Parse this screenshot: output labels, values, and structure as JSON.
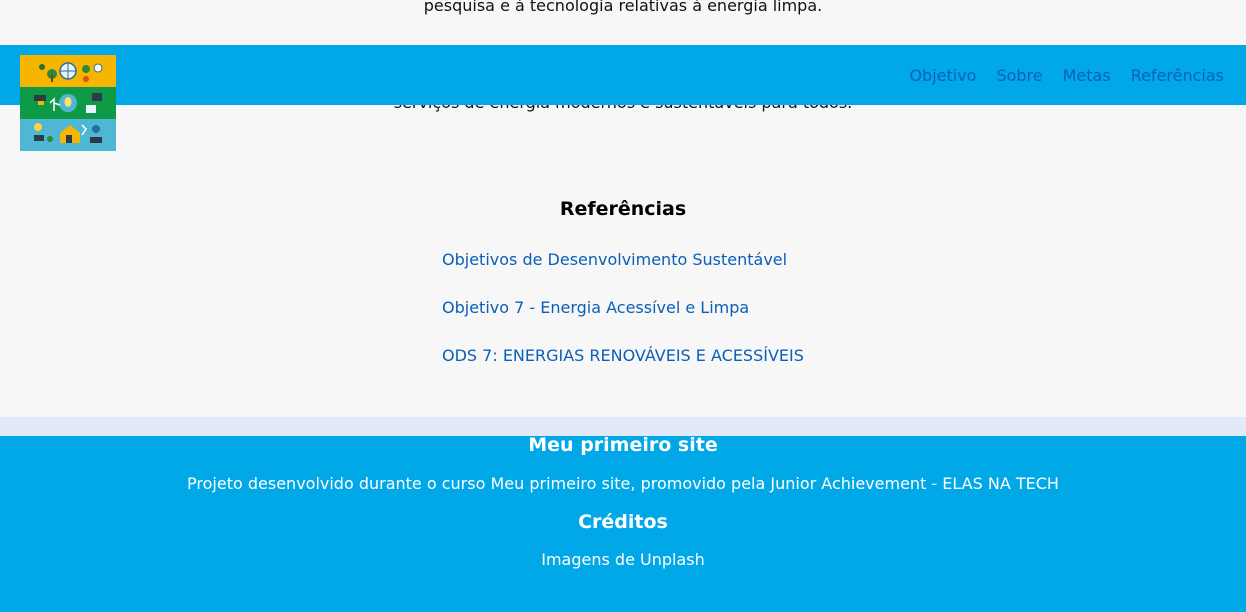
{
  "page": {
    "top_text": "pesquisa e à tecnologia relativas à energia limpa.",
    "under_header_text": "serviços de energia modernos e sustentáveis para todos."
  },
  "header": {
    "logo_alt": "energia limpa",
    "nav": [
      {
        "label": "Objetivo"
      },
      {
        "label": "Sobre"
      },
      {
        "label": "Metas"
      },
      {
        "label": "Referências"
      }
    ]
  },
  "references": {
    "title": "Referências",
    "links": [
      {
        "label": "Objetivos de Desenvolvimento Sustentável"
      },
      {
        "label": "Objetivo 7 - Energia Acessível e Limpa"
      },
      {
        "label": "ODS 7: ENERGIAS RENOVÁVEIS E ACESSÍVEIS"
      }
    ]
  },
  "footer": {
    "site_title": "Meu primeiro site",
    "site_text": "Projeto desenvolvido durante o curso Meu primeiro site, promovido pela Junior Achievement - ELAS NA TECH",
    "credits_title": "Créditos",
    "credits_text": "Imagens de Unplash"
  },
  "colors": {
    "header_bg": "#00a8e8",
    "nav_link": "#0a5fc4",
    "ref_link": "#0a5fb8",
    "band": "#e1e9fb",
    "footer_bg": "#00a8e8"
  }
}
